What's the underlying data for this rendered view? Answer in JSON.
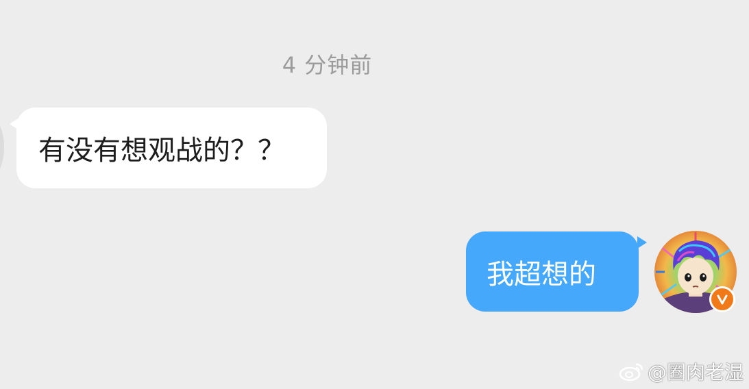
{
  "chat": {
    "timestamp": "4 分钟前",
    "messages": [
      {
        "side": "left",
        "text": "有没有想观战的？？"
      },
      {
        "side": "right",
        "text": "我超想的"
      }
    ],
    "verified_badge": "V"
  },
  "watermark": {
    "text": "@圈肉老湿"
  },
  "colors": {
    "background": "#ededed",
    "incoming_bubble": "#ffffff",
    "outgoing_bubble": "#45a8fa",
    "timestamp_text": "#9b9b9b",
    "verified_badge": "#f07a1a"
  }
}
